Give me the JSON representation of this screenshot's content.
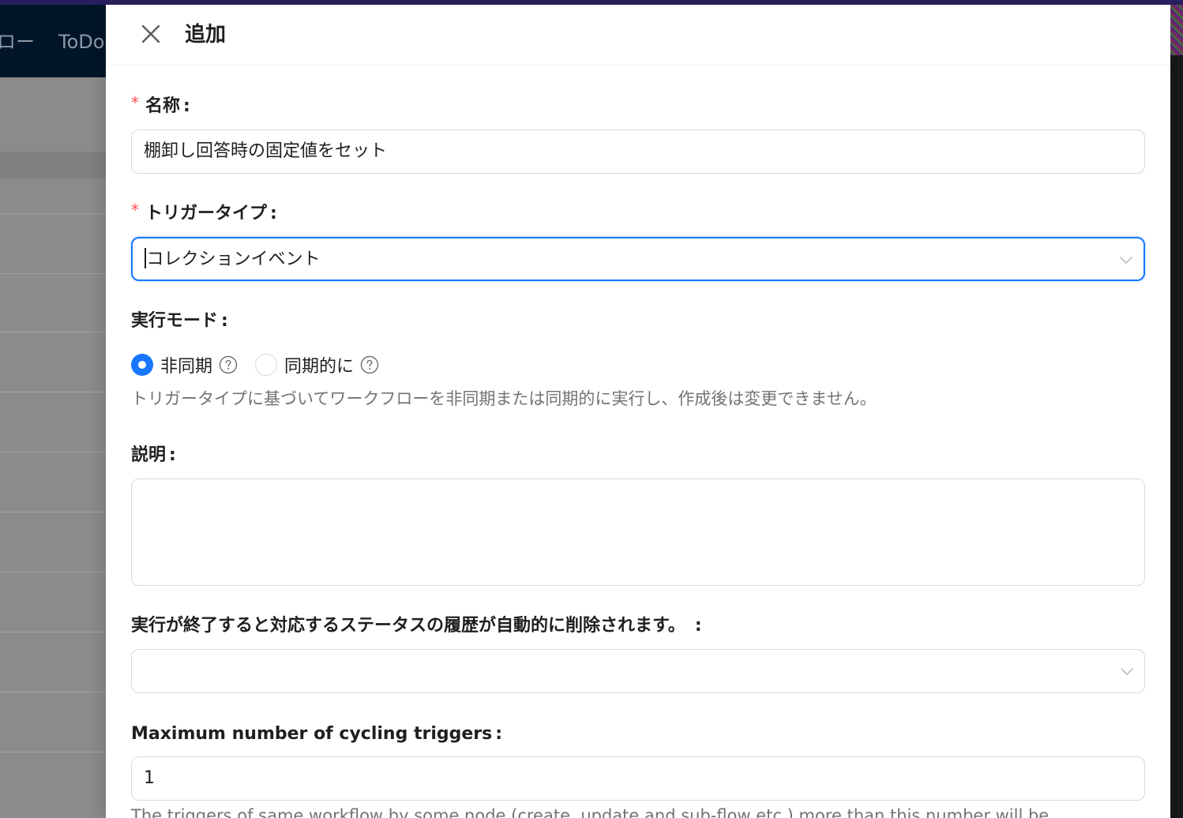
{
  "background": {
    "nav_items": [
      "ロー",
      "ToDo"
    ]
  },
  "drawer": {
    "title": "追加",
    "close_icon": "close-icon"
  },
  "form": {
    "name": {
      "label": "名称",
      "required": true,
      "value": "棚卸し回答時の固定値をセット"
    },
    "trigger_type": {
      "label": "トリガータイプ",
      "required": true,
      "value": "コレクションイベント"
    },
    "execution_mode": {
      "label": "実行モード",
      "options": [
        {
          "label": "非同期",
          "checked": true
        },
        {
          "label": "同期的に",
          "checked": false
        }
      ],
      "help": "トリガータイプに基づいてワークフローを非同期または同期的に実行し、作成後は変更できません。"
    },
    "description": {
      "label": "説明",
      "value": ""
    },
    "auto_delete": {
      "label": "実行が終了すると対応するステータスの履歴が自動的に削除されます。",
      "value": ""
    },
    "max_cycling": {
      "label": "Maximum number of cycling triggers",
      "value": "1",
      "help": "The triggers of same workflow by some node (create, update and sub-flow etc.) more than this number will be"
    },
    "colon": ":"
  },
  "colors": {
    "primary": "#1677ff",
    "required": "#ff4d4f",
    "header_bg": "#001529"
  }
}
